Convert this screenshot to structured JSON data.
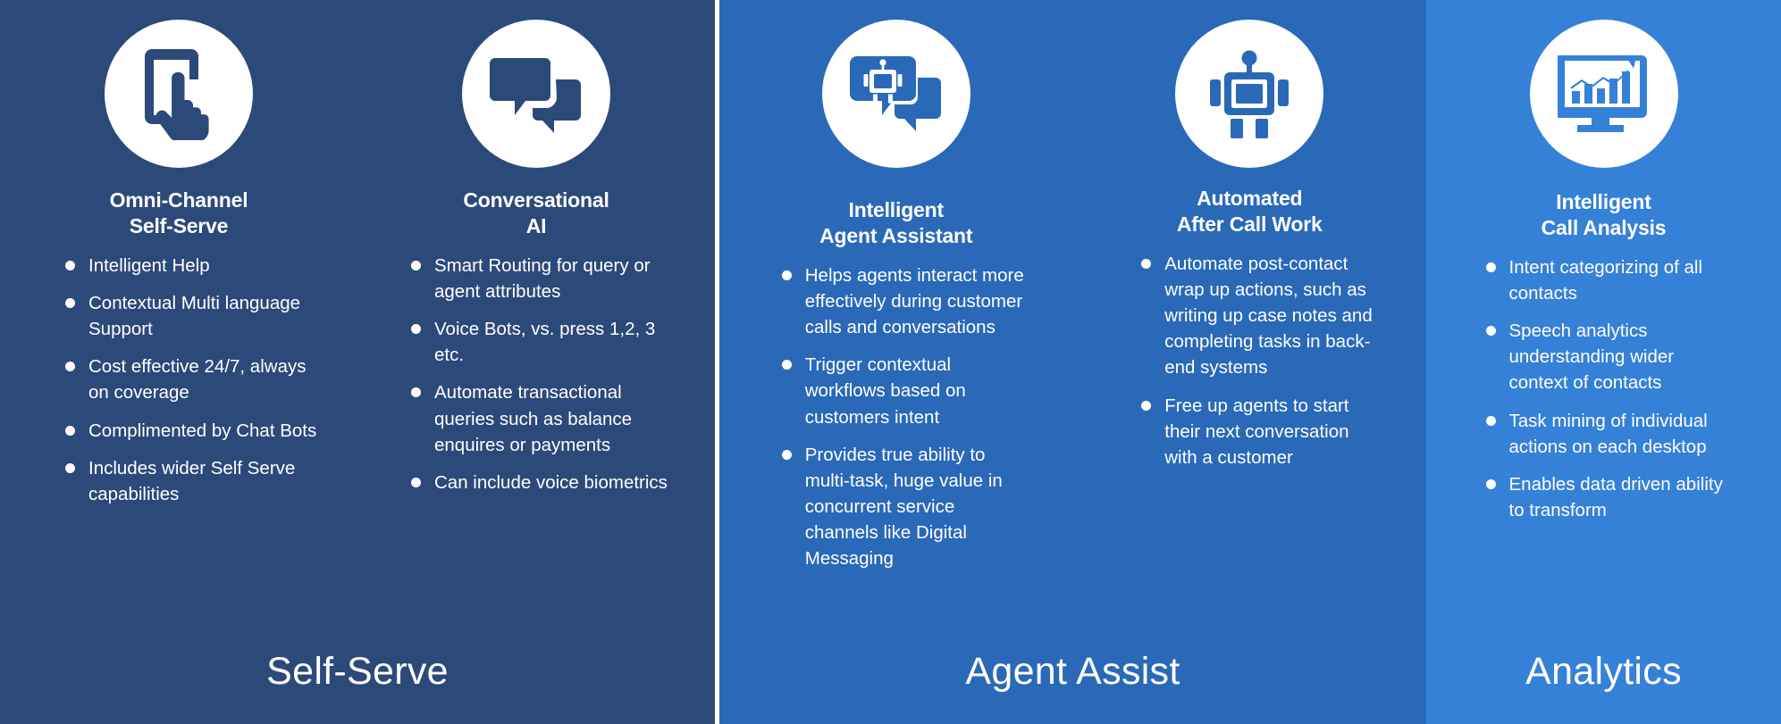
{
  "colors": {
    "self_serve_bg": "#2c4a79",
    "agent_assist_bg": "#2a69b8",
    "analytics_bg": "#3581d8",
    "icon_circle": "#ffffff",
    "text": "#ffffff"
  },
  "sections": [
    {
      "id": "self-serve",
      "label": "Self-Serve",
      "cards": [
        {
          "id": "omni-channel-self-serve",
          "icon": "hand-tapping-smartphone-icon",
          "title_line1": "Omni-Channel",
          "title_line2": "Self-Serve",
          "bullets": [
            "Intelligent Help",
            "Contextual Multi language Support",
            "Cost effective 24/7, always on coverage",
            "Complimented by Chat Bots",
            "Includes wider Self Serve capabilities"
          ]
        },
        {
          "id": "conversational-ai",
          "icon": "chat-bubbles-icon",
          "title_line1": "Conversational",
          "title_line2": "AI",
          "bullets": [
            "Smart Routing for query or agent attributes",
            "Voice Bots, vs. press 1,2, 3 etc.",
            "Automate transactional queries such as balance enquires or payments",
            "Can include voice biometrics"
          ]
        }
      ]
    },
    {
      "id": "agent-assist",
      "label": "Agent Assist",
      "cards": [
        {
          "id": "intelligent-agent-assistant",
          "icon": "robot-chat-bubble-icon",
          "title_line1": "Intelligent",
          "title_line2": "Agent Assistant",
          "bullets": [
            "Helps agents interact more effectively during customer calls and conversations",
            "Trigger contextual workflows based on customers intent",
            "Provides true ability to multi-task, huge value in concurrent service channels like Digital Messaging"
          ]
        },
        {
          "id": "automated-after-call-work",
          "icon": "robot-icon",
          "title_line1": "Automated",
          "title_line2": "After Call Work",
          "bullets": [
            "Automate post-contact wrap up actions, such as writing up case notes and completing tasks in back-end systems",
            "Free up agents to start their next conversation with a customer"
          ]
        }
      ]
    },
    {
      "id": "analytics",
      "label": "Analytics",
      "cards": [
        {
          "id": "intelligent-call-analysis",
          "icon": "monitor-chart-icon",
          "title_line1": "Intelligent",
          "title_line2": "Call Analysis",
          "bullets": [
            "Intent categorizing of all contacts",
            "Speech analytics understanding wider context of contacts",
            "Task mining of individual actions on each desktop",
            "Enables data driven ability to transform"
          ]
        }
      ]
    }
  ]
}
